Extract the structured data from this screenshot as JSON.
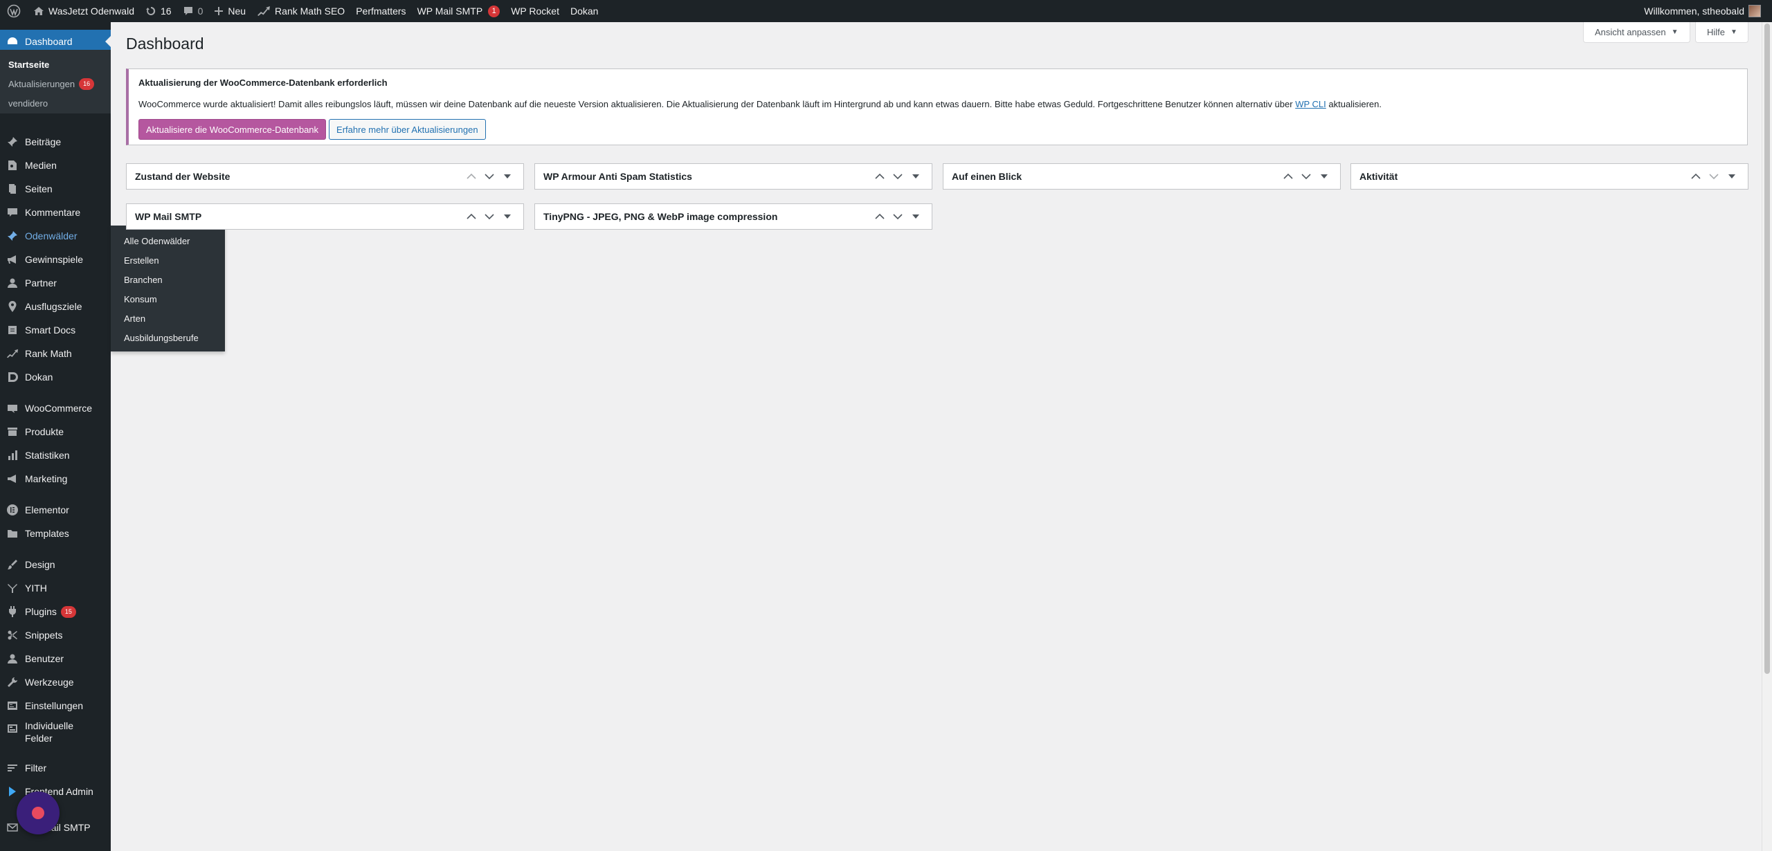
{
  "adminbar": {
    "site_name": "WasJetzt Odenwald",
    "updates_count": "16",
    "comments_count": "0",
    "new_label": "Neu",
    "rankmath": "Rank Math SEO",
    "perfmatters": "Perfmatters",
    "wpmail": "WP Mail SMTP",
    "wpmail_badge": "1",
    "wprocket": "WP Rocket",
    "dokan": "Dokan",
    "greeting": "Willkommen, stheobald"
  },
  "screen_meta": {
    "options": "Ansicht anpassen",
    "help": "Hilfe"
  },
  "sidebar": {
    "dashboard": "Dashboard",
    "sub": {
      "startseite": "Startseite",
      "updates": "Aktualisierungen",
      "updates_badge": "16",
      "vendidero": "vendidero"
    },
    "items": {
      "beitraege": "Beiträge",
      "medien": "Medien",
      "seiten": "Seiten",
      "kommentare": "Kommentare",
      "odenwaelder": "Odenwälder",
      "gewinnspiele": "Gewinnspiele",
      "partner": "Partner",
      "ausflugsziele": "Ausflugsziele",
      "smartdocs": "Smart Docs",
      "rankmath": "Rank Math",
      "dokan": "Dokan",
      "woocommerce": "WooCommerce",
      "produkte": "Produkte",
      "statistiken": "Statistiken",
      "marketing": "Marketing",
      "elementor": "Elementor",
      "templates": "Templates",
      "design": "Design",
      "yith": "YITH",
      "plugins": "Plugins",
      "plugins_badge": "15",
      "snippets": "Snippets",
      "benutzer": "Benutzer",
      "werkzeuge": "Werkzeuge",
      "einstellungen": "Einstellungen",
      "felder": "Individuelle Felder",
      "filter": "Filter",
      "frontend_admin": "Frontend Admin",
      "mailsmtp": "WP Mail SMTP"
    }
  },
  "flyout": {
    "items": [
      "Alle Odenwälder",
      "Erstellen",
      "Branchen",
      "Konsum",
      "Arten",
      "Ausbildungsberufe"
    ]
  },
  "main": {
    "title": "Dashboard",
    "notice": {
      "title": "Aktualisierung der WooCommerce-Datenbank erforderlich",
      "text_before": "WooCommerce wurde aktualisiert! Damit alles reibungslos läuft, müssen wir deine Datenbank auf die neueste Version aktualisieren. Die Aktualisierung der Datenbank läuft im Hintergrund ab und kann etwas dauern. Bitte habe etwas Geduld. Fortgeschrittene Benutzer können alternativ über",
      "link": "WP CLI",
      "text_after": "aktualisieren.",
      "primary_button": "Aktualisiere die WooCommerce-Datenbank",
      "secondary_button": "Erfahre mehr über Aktualisierungen"
    },
    "widgets": [
      "Zustand der Website",
      "WP Armour Anti Spam Statistics",
      "Auf einen Blick",
      "Aktivität",
      "WP Mail SMTP",
      "TinyPNG - JPEG, PNG & WebP image compression"
    ]
  }
}
